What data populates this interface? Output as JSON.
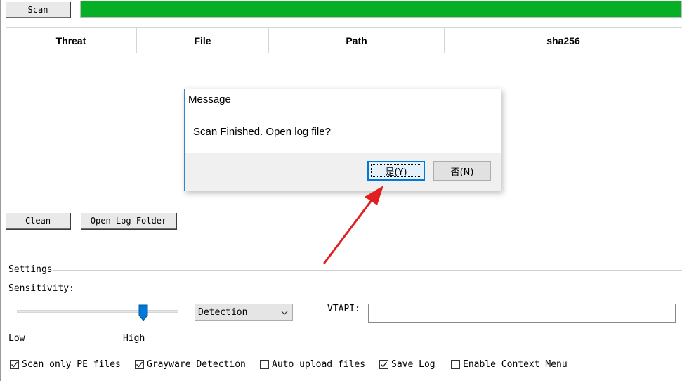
{
  "toolbar": {
    "scan_label": "Scan",
    "progress_percent": 100
  },
  "colors": {
    "progress": "#06b025",
    "dialog_border": "#2f86d6",
    "annotation_arrow": "#e02020"
  },
  "table": {
    "columns": [
      "Threat",
      "File",
      "Path",
      "sha256"
    ],
    "rows": []
  },
  "actions": {
    "clean_label": "Clean",
    "open_log_folder_label": "Open Log Folder"
  },
  "dialog": {
    "title": "Message",
    "message": "Scan Finished. Open log file?",
    "yes_label": "是(Y)",
    "no_label": "否(N)"
  },
  "settings": {
    "group_label": "Settings",
    "sensitivity_label": "Sensitivity:",
    "sensitivity_low_label": "Low",
    "sensitivity_high_label": "High",
    "sensitivity_level": 0.8,
    "mode_selected": "Detection",
    "vtapi_label": "VTAPI:",
    "vtapi_value": "",
    "options": [
      {
        "label": "Scan only PE files",
        "checked": true
      },
      {
        "label": "Grayware Detection",
        "checked": true
      },
      {
        "label": "Auto upload files",
        "checked": false
      },
      {
        "label": "Save Log",
        "checked": true
      },
      {
        "label": "Enable Context Menu",
        "checked": false
      }
    ]
  },
  "annotation": {
    "icon": "red-arrow-icon"
  }
}
